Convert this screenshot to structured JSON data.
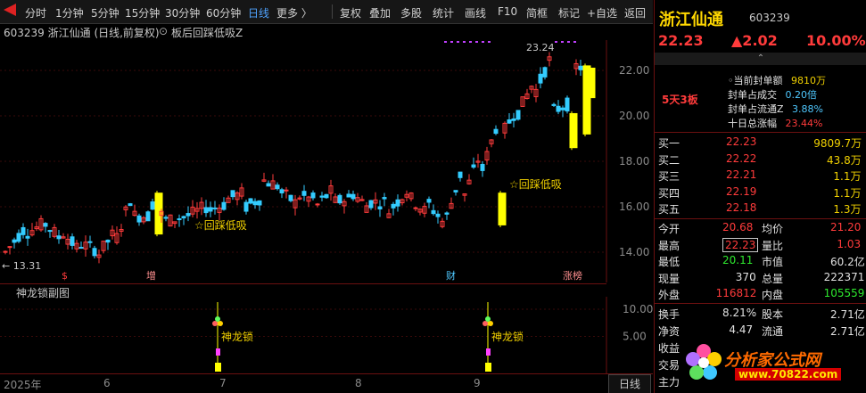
{
  "toolbar": {
    "items": [
      "分时",
      "1分钟",
      "5分钟",
      "15分钟",
      "30分钟",
      "60分钟",
      "日线",
      "更多 〉"
    ],
    "actions": [
      "复权",
      "叠加",
      "多股",
      "统计",
      "画线",
      "F10",
      "简框",
      "标记",
      "+自选",
      "返回"
    ]
  },
  "title_line": {
    "code_title": "603239 浙江仙通 (日线,前复权)",
    "indicator": "板后回踩低吸Z"
  },
  "main_chart": {
    "y_labels": [
      "22.00",
      "20.00",
      "18.00",
      "16.00",
      "14.00"
    ],
    "high_label": "23.24",
    "low_label": "13.31",
    "annotations": [
      "☆回踩低吸",
      "☆回踩低吸"
    ],
    "event_markers": [
      "$",
      "增",
      "财",
      "涨榜"
    ]
  },
  "sub_chart": {
    "title": "神龙锁副图",
    "y_labels": [
      "10.00",
      "5.00"
    ],
    "signal_label": "神龙锁",
    "signals": [
      "神龙锁",
      "神龙锁"
    ]
  },
  "date_axis": {
    "labels": [
      "2025年",
      "6",
      "7",
      "8",
      "9"
    ],
    "period_tab": "日线"
  },
  "panel": {
    "stock_name": "浙江仙通",
    "stock_code": "603239",
    "price": "22.23",
    "change": "▲2.02",
    "change_pct": "10.00%",
    "collapse_glyph": "⌃",
    "seal": [
      {
        "label": "当前封单额",
        "value": "9810万"
      },
      {
        "label": "封单占成交",
        "value": "0.20倍"
      },
      {
        "label": "封单占流通Z",
        "value": "3.88%"
      },
      {
        "label": "十日总涨幅",
        "value": "23.44%"
      }
    ],
    "board_label": "5天3板",
    "bids": [
      {
        "label": "买一",
        "price": "22.23",
        "vol": "9809.7万"
      },
      {
        "label": "买二",
        "price": "22.22",
        "vol": "43.8万"
      },
      {
        "label": "买三",
        "price": "22.21",
        "vol": "1.1万"
      },
      {
        "label": "买四",
        "price": "22.19",
        "vol": "1.1万"
      },
      {
        "label": "买五",
        "price": "22.18",
        "vol": "1.3万"
      }
    ],
    "stats": [
      {
        "l1": "今开",
        "v1": "20.68",
        "l2": "均价",
        "v2": "21.20"
      },
      {
        "l1": "最高",
        "v1": "22.23",
        "l2": "量比",
        "v2": "1.03"
      },
      {
        "l1": "最低",
        "v1": "20.11",
        "l2": "市值",
        "v2": "60.2亿"
      },
      {
        "l1": "现量",
        "v1": "370",
        "l2": "总量",
        "v2": "222371"
      },
      {
        "l1": "外盘",
        "v1": "116812",
        "l2": "内盘",
        "v2": "105559"
      }
    ],
    "stats2": [
      {
        "l1": "换手",
        "v1": "8.21%",
        "l2": "股本",
        "v2": "2.71亿"
      },
      {
        "l1": "净资",
        "v1": "4.47",
        "l2": "流通",
        "v2": "2.71亿"
      },
      {
        "l1": "收益",
        "v1": "",
        "l2": "",
        "v2": ""
      },
      {
        "l1": "交易",
        "v1": "",
        "l2": "",
        "v2": ""
      },
      {
        "l1": "主力",
        "v1": "",
        "l2": "",
        "v2": ""
      }
    ]
  },
  "watermark": {
    "text": "分析家公式网",
    "url": "www.70822.com"
  },
  "colors": {
    "up": "#ff3b3b",
    "down": "#33ccff",
    "limit_bar": "#ffff00",
    "axis_border": "#6b1010"
  }
}
